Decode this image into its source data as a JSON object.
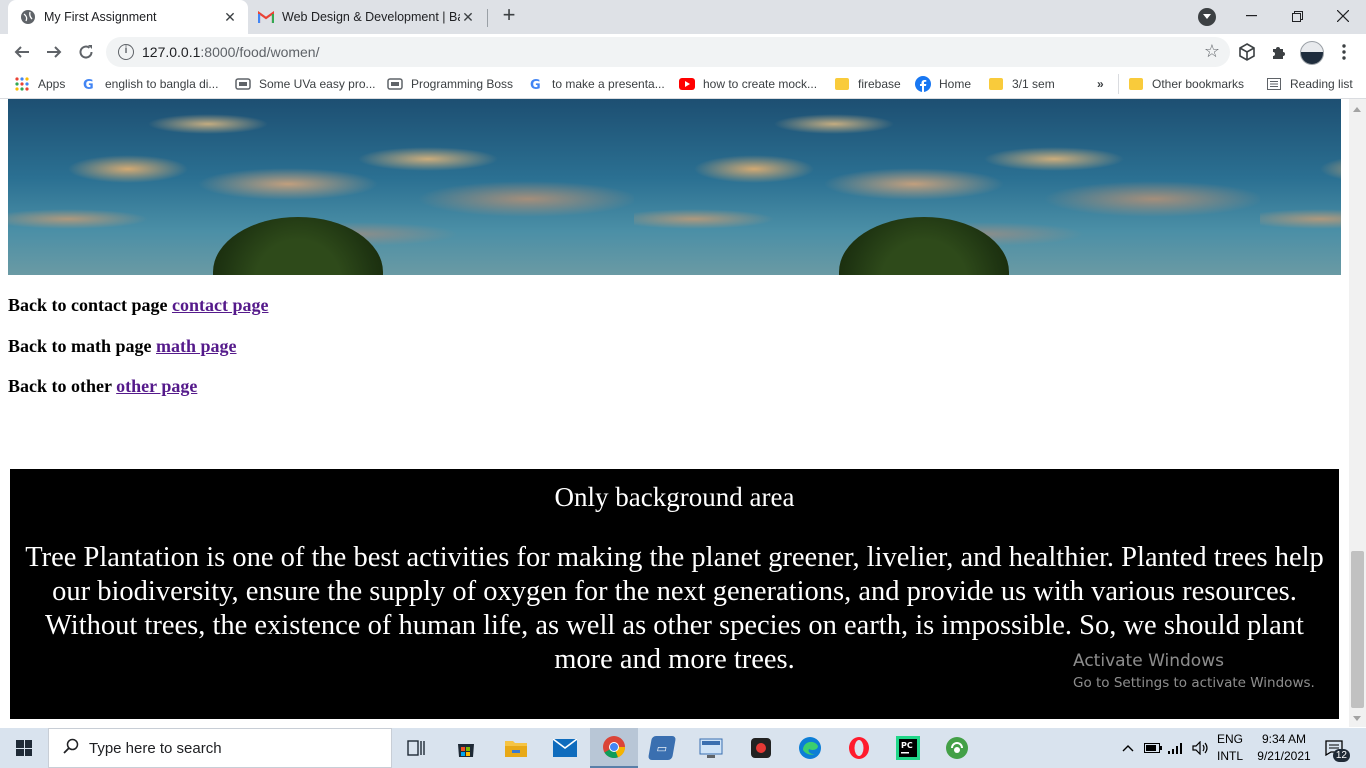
{
  "browser": {
    "tabs": [
      {
        "title": "My First Assignment",
        "active": true,
        "icon": "globe-icon"
      },
      {
        "title": "Web Design & Development | Ba",
        "active": false,
        "icon": "gmail-icon"
      }
    ],
    "new_tab_label": "+",
    "address": {
      "host": "127.0.0.1",
      "path": ":8000/food/women/"
    },
    "bookmarks": [
      {
        "label": "Apps",
        "icon": "apps-grid-icon"
      },
      {
        "label": "english to bangla di...",
        "icon": "google-icon"
      },
      {
        "label": "Some UVa easy pro...",
        "icon": "site-icon"
      },
      {
        "label": "Programming Boss",
        "icon": "site-icon"
      },
      {
        "label": "to make a presenta...",
        "icon": "google-icon"
      },
      {
        "label": "how to create mock...",
        "icon": "youtube-icon"
      },
      {
        "label": "firebase",
        "icon": "folder-icon"
      },
      {
        "label": "Home",
        "icon": "facebook-icon"
      },
      {
        "label": "3/1 sem",
        "icon": "folder-icon"
      }
    ],
    "bookmarks_overflow": "»",
    "other_bookmarks": "Other bookmarks",
    "reading_list": "Reading list"
  },
  "page": {
    "links": [
      {
        "prefix": "Back to contact page ",
        "link": "contact page"
      },
      {
        "prefix": "Back to math page ",
        "link": "math page"
      },
      {
        "prefix": "Back to other ",
        "link": "other page"
      }
    ],
    "black_box": {
      "heading": "Only background area",
      "paragraph": "Tree Plantation is one of the best activities for making the planet greener, livelier, and healthier. Planted trees help our biodiversity, ensure the supply of oxygen for the next generations, and provide us with various resources. Without trees, the existence of human life, as well as other species on earth, is impossible. So, we should plant more and more trees."
    }
  },
  "watermark": {
    "title": "Activate Windows",
    "subtitle": "Go to Settings to activate Windows."
  },
  "taskbar": {
    "search_placeholder": "Type here to search",
    "language": {
      "line1": "ENG",
      "line2": "INTL"
    },
    "time": "9:34 AM",
    "date": "9/21/2021",
    "notification_count": "12"
  },
  "colors": {
    "link_visited": "#551a8b",
    "black_box_bg": "#000000",
    "tabstrip_bg": "#dee1e6"
  }
}
